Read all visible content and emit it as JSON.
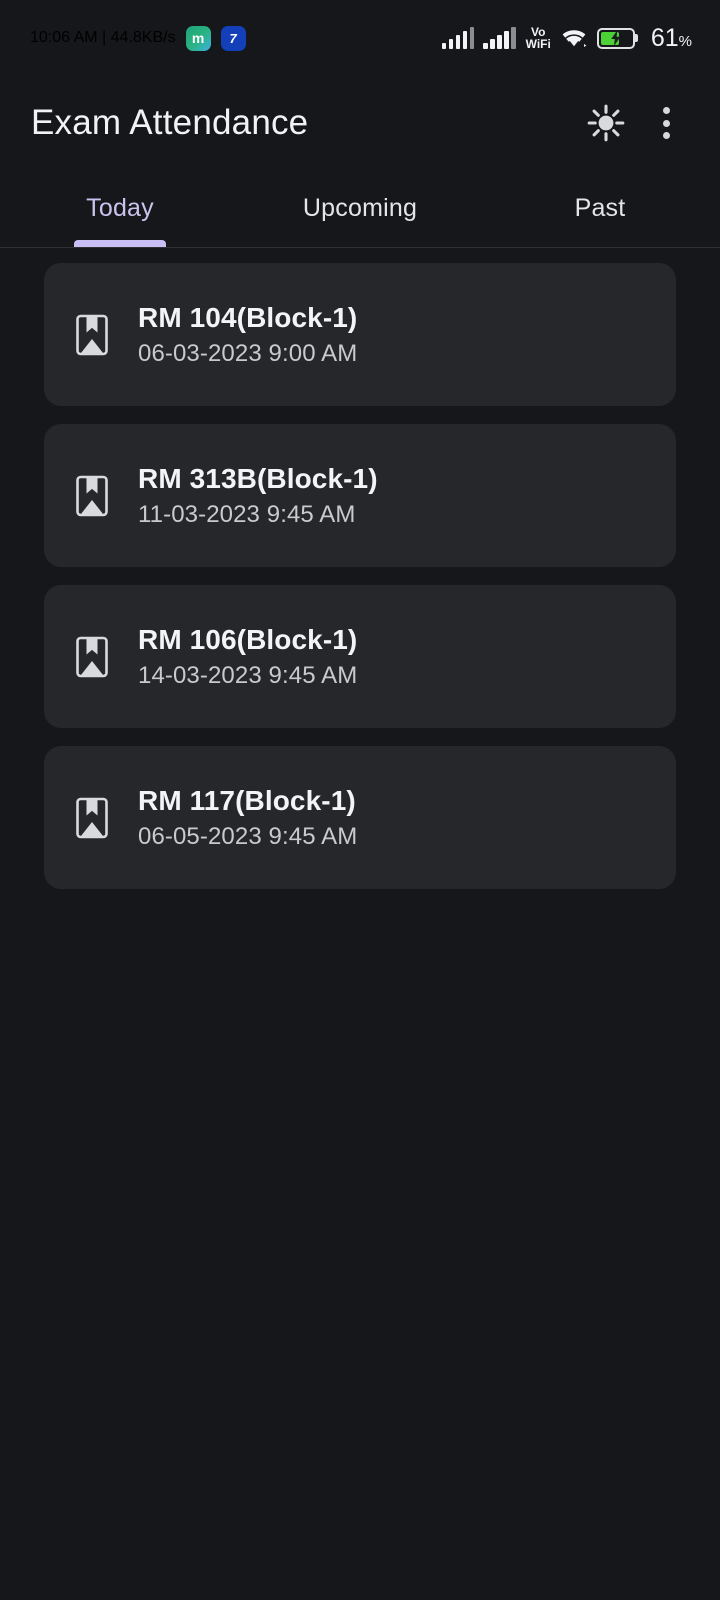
{
  "status_bar": {
    "clock": "10:06 AM | 44.8KB/s",
    "notification_badges": [
      {
        "name": "messenger-badge",
        "glyph": "m"
      },
      {
        "name": "app-badge",
        "glyph": "7"
      }
    ],
    "signal_1": "signal-bars-icon",
    "signal_2": "signal-bars-icon",
    "volte_top": "Vo",
    "volte_bottom": "WiFi",
    "wifi": "wifi-icon",
    "battery_icon": "battery-charging-icon",
    "battery_level": 61,
    "battery_text": "61",
    "battery_pct_sign": "%"
  },
  "app_bar": {
    "title": "Exam Attendance",
    "brightness_icon": "brightness-icon",
    "overflow_icon": "overflow-menu-icon"
  },
  "tabs": {
    "active_index": 0,
    "items": [
      {
        "label": "Today"
      },
      {
        "label": "Upcoming"
      },
      {
        "label": "Past"
      }
    ]
  },
  "exam_list": {
    "items": [
      {
        "icon": "book-bookmark-icon",
        "room": "RM 104(Block-1)",
        "datetime": "06-03-2023 9:00 AM"
      },
      {
        "icon": "book-bookmark-icon",
        "room": "RM 313B(Block-1)",
        "datetime": "11-03-2023 9:45 AM"
      },
      {
        "icon": "book-bookmark-icon",
        "room": "RM 106(Block-1)",
        "datetime": "14-03-2023 9:45 AM"
      },
      {
        "icon": "book-bookmark-icon",
        "room": "RM 117(Block-1)",
        "datetime": "06-05-2023 9:45 AM"
      }
    ]
  },
  "colors": {
    "background": "#16171a",
    "card": "#25272b",
    "accent": "#c9bef4",
    "accent_text": "#cbc2ef",
    "primary_text": "#f3f4f6",
    "secondary_text": "#c9cace",
    "battery_green": "#4cd137"
  }
}
